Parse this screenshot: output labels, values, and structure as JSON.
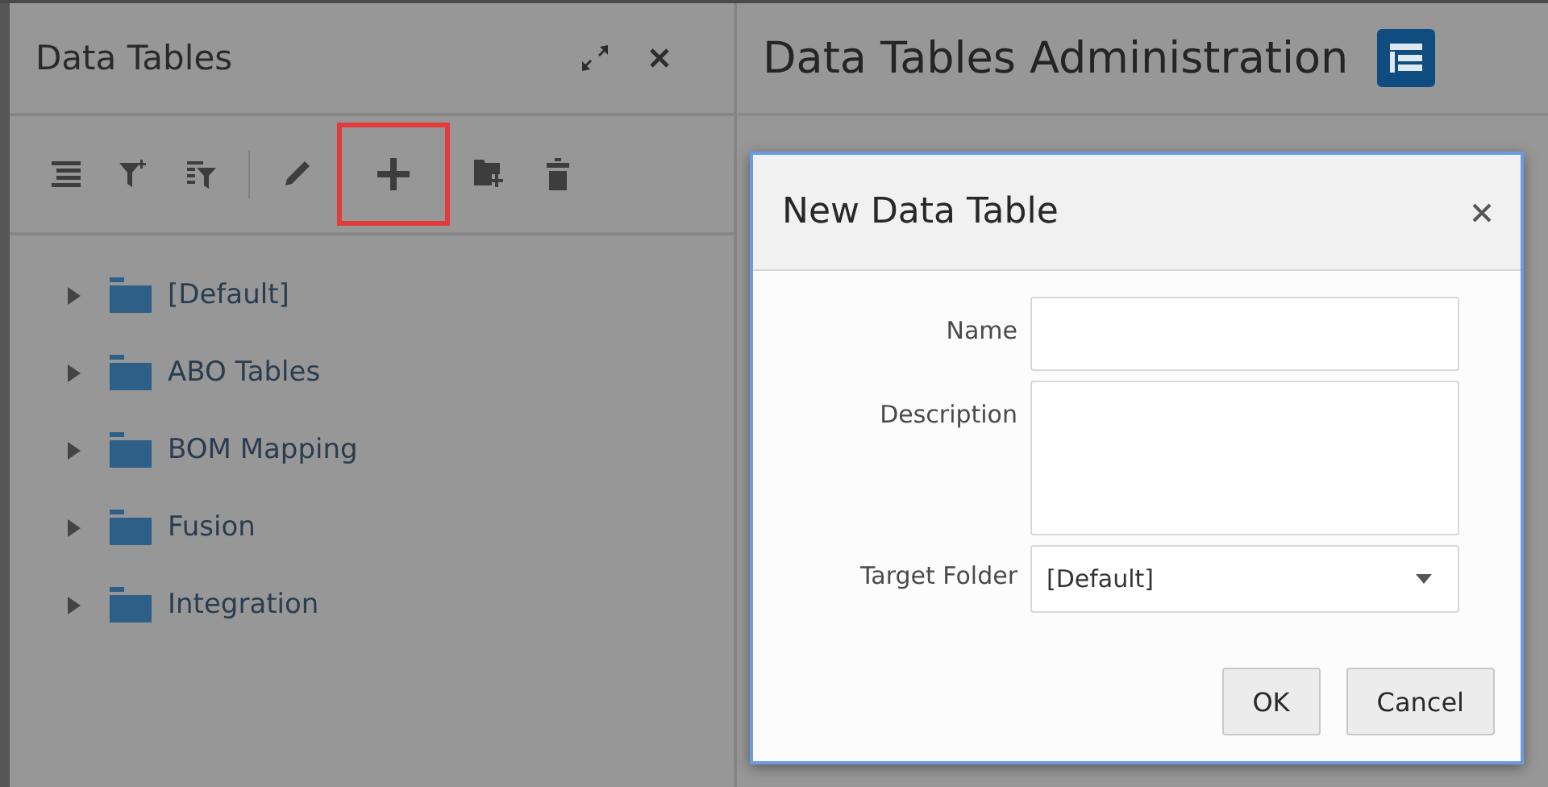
{
  "left_panel": {
    "title": "Data Tables",
    "toolbar": [
      {
        "kind": "list",
        "highlighted": false
      },
      {
        "kind": "filter-add",
        "highlighted": false
      },
      {
        "kind": "filter-list",
        "highlighted": false
      },
      {
        "kind": "separator"
      },
      {
        "kind": "edit",
        "highlighted": false
      },
      {
        "kind": "add",
        "highlighted": true
      },
      {
        "kind": "folder-add",
        "highlighted": false
      },
      {
        "kind": "delete",
        "highlighted": false
      }
    ],
    "tree": [
      {
        "label": "[Default]",
        "expanded": false
      },
      {
        "label": "ABO Tables",
        "expanded": false
      },
      {
        "label": "BOM Mapping",
        "expanded": false
      },
      {
        "label": "Fusion",
        "expanded": false
      },
      {
        "label": "Integration",
        "expanded": false
      }
    ]
  },
  "main_panel": {
    "title": "Data Tables Administration"
  },
  "dialog": {
    "title": "New Data Table",
    "fields": [
      {
        "kind": "text",
        "label": "Name"
      },
      {
        "kind": "textarea",
        "label": "Description"
      },
      {
        "kind": "select",
        "label": "Target Folder",
        "value": "[Default]"
      }
    ],
    "buttons": [
      "OK",
      "Cancel"
    ]
  }
}
